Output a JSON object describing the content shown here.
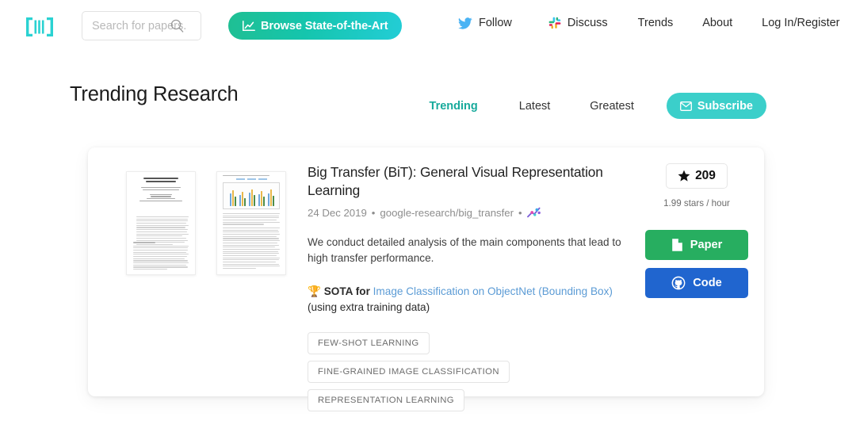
{
  "navbar": {
    "logo_name": "papers-with-code-logo",
    "search": {
      "placeholder": "Search for papers.",
      "value": ""
    },
    "sota_button": "Browse State-of-the-Art",
    "links": [
      {
        "label": "Follow",
        "icon": "twitter-icon"
      },
      {
        "label": "Discuss",
        "icon": "slack-icon"
      },
      {
        "label": "Trends",
        "icon": ""
      },
      {
        "label": "About",
        "icon": ""
      },
      {
        "label": "Log In/Register",
        "icon": ""
      }
    ]
  },
  "header": {
    "title": "Trending Research",
    "tabs": [
      {
        "label": "Trending",
        "active": true
      },
      {
        "label": "Latest",
        "active": false
      },
      {
        "label": "Greatest",
        "active": false
      }
    ],
    "subscribe_label": "Subscribe"
  },
  "paper": {
    "title": "Big Transfer (BiT): General Visual Representation Learning",
    "date": "24 Dec 2019",
    "separator1": "•",
    "repo": "google-research/big_transfer",
    "separator2": "•",
    "social_icon": "social-graph-icon",
    "abstract": "We conduct detailed analysis of the main components that lead to high transfer performance.",
    "sota": {
      "trophy": "🏆",
      "prefix": "SOTA for",
      "link": "Image Classification on ObjectNet (Bounding Box)",
      "suffix": "(using extra training data)"
    },
    "tags": [
      "FEW-SHOT LEARNING",
      "FINE-GRAINED IMAGE CLASSIFICATION",
      "REPRESENTATION LEARNING"
    ],
    "stars": "209",
    "star_rate": "1.99 stars / hour",
    "paper_button": "Paper",
    "code_button": "Code"
  },
  "colors": {
    "brand_teal": "#3bcfca",
    "accent_green": "#27ae60",
    "accent_blue": "#2065cf",
    "active_tab": "#18aa9c",
    "link_blue": "#5b9bd5"
  }
}
